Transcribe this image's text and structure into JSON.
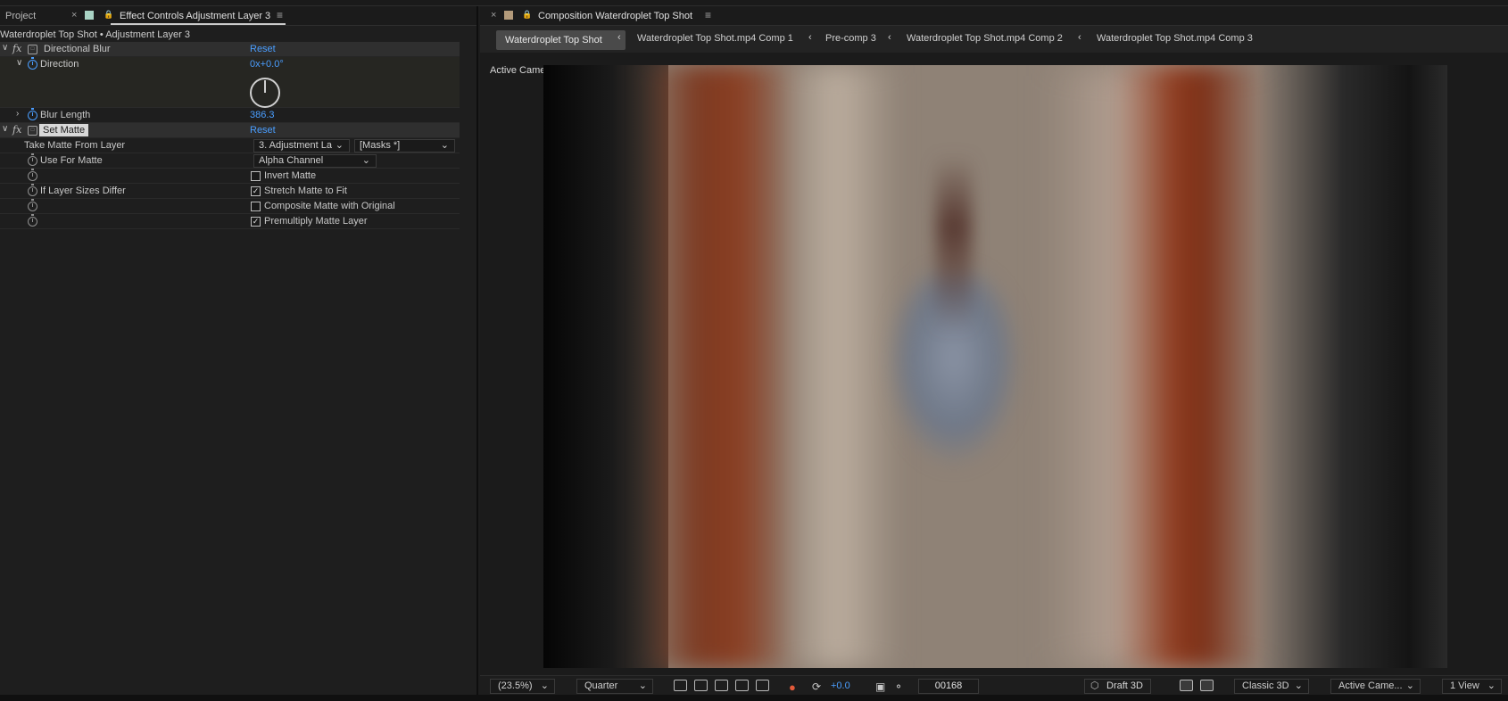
{
  "left_panel": {
    "tabs": {
      "project": "Project",
      "close": "×",
      "effect_controls": "Effect Controls Adjustment Layer 3",
      "menu": "≡",
      "swatch_color": "#a9d3c4"
    },
    "layer_title": "Waterdroplet Top Shot • Adjustment Layer 3",
    "effects": {
      "directional_blur": {
        "name": "Directional Blur",
        "reset": "Reset",
        "direction_label": "Direction",
        "direction_value": "0x+0.0°",
        "blur_length_label": "Blur Length",
        "blur_length_value": "386.3"
      },
      "set_matte": {
        "name": "Set Matte",
        "reset": "Reset",
        "take_matte_label": "Take Matte From Layer",
        "layer_dropdown": "3. Adjustment La",
        "masks_dropdown": "[Masks *]",
        "use_for_matte_label": "Use For Matte",
        "use_for_matte_value": "Alpha Channel",
        "invert_matte": "Invert Matte",
        "invert_checked": false,
        "layer_sizes_label": "If Layer Sizes Differ",
        "stretch_matte": "Stretch Matte to Fit",
        "stretch_checked": true,
        "composite_matte": "Composite Matte with Original",
        "composite_checked": false,
        "premultiply": "Premultiply Matte Layer",
        "premultiply_checked": true
      }
    }
  },
  "composition": {
    "tab_title": "Composition Waterdroplet Top Shot",
    "close": "×",
    "menu": "≡",
    "swatch_color": "#b39a7a",
    "breadcrumbs": [
      "Waterdroplet Top Shot",
      "Waterdroplet Top Shot.mp4 Comp 1",
      "Pre-comp 3",
      "Waterdroplet Top Shot.mp4 Comp 2",
      "Waterdroplet Top Shot.mp4 Comp 3"
    ],
    "camera_label": "Active Camera (Default)",
    "viewer_bar": {
      "zoom": "(23.5%)",
      "resolution": "Quarter",
      "exposure": "+0.0",
      "timecode": "00168",
      "draft3d": "Draft 3D",
      "renderer": "Classic 3D",
      "camera": "Active Came...",
      "views": "1 View"
    }
  },
  "icons": [
    "close-icon",
    "lock-icon",
    "panel-menu-icon",
    "twirl-icon",
    "fx-icon",
    "stopwatch-icon",
    "chevron-down-icon",
    "checkbox-icon",
    "breadcrumb-arrow-icon",
    "snapshot-icon",
    "grid-icon",
    "mask-icon",
    "color-channel-icon",
    "exposure-reset-icon",
    "draft3d-icon"
  ]
}
